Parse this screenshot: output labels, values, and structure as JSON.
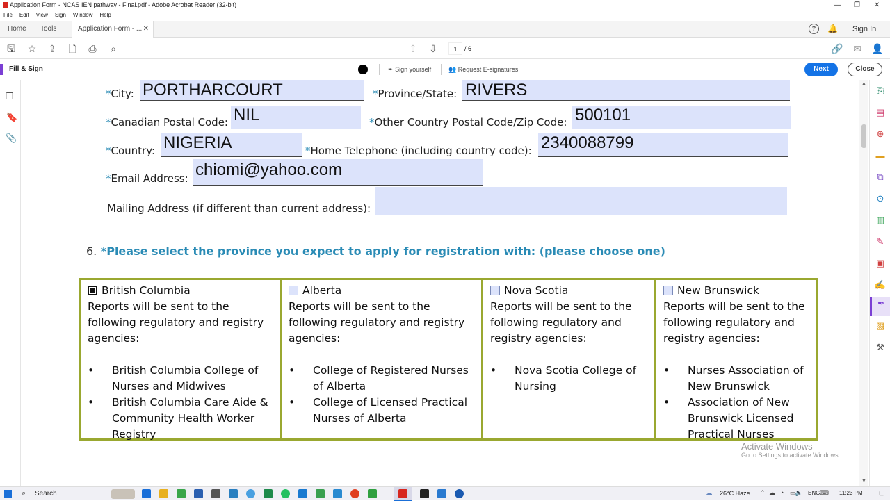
{
  "window": {
    "title": "Application Form - NCAS IEN pathway - Final.pdf - Adobe Acrobat Reader (32-bit)"
  },
  "menu": [
    "File",
    "Edit",
    "View",
    "Sign",
    "Window",
    "Help"
  ],
  "tabs": {
    "home": "Home",
    "tools": "Tools",
    "document": "Application Form - ...",
    "sign_in": "Sign In"
  },
  "toolbar": {
    "page_current": "1",
    "page_total": "/ 6"
  },
  "fill_sign": {
    "title": "Fill & Sign",
    "sign_yourself": "Sign yourself",
    "request": "Request E-signatures",
    "next": "Next",
    "close": "Close"
  },
  "form": {
    "city": {
      "label": "City:",
      "value": "PORTHARCOURT"
    },
    "province": {
      "label": "Province/State:",
      "value": "RIVERS"
    },
    "postal_ca": {
      "label": "Canadian Postal Code:",
      "value": "NIL"
    },
    "postal_other": {
      "label": "Other Country Postal Code/Zip Code:",
      "value": "500101"
    },
    "country": {
      "label": "Country:",
      "value": "NIGERIA"
    },
    "phone": {
      "label": "Home Telephone (including country code):",
      "value": "2340088799"
    },
    "email": {
      "label": "Email Address:",
      "value": "chiomi@yahoo.com"
    },
    "mailing": {
      "label": "Mailing Address (if different than current address):",
      "value": ""
    },
    "asterisk": "*"
  },
  "question6": {
    "number": "6.",
    "text": "*Please select the province you expect to apply for registration with: (please choose one)"
  },
  "provinces": [
    {
      "name": "British Columbia",
      "checked": true,
      "intro": "Reports will be sent to the following regulatory and registry agencies:",
      "agencies": [
        "British Columbia College of Nurses and Midwives",
        "British Columbia Care Aide & Community Health Worker Registry"
      ]
    },
    {
      "name": "Alberta",
      "checked": false,
      "intro": "Reports will be sent to the following regulatory and registry agencies:",
      "agencies": [
        "College of Registered Nurses of Alberta",
        "College of Licensed Practical Nurses of Alberta"
      ]
    },
    {
      "name": "Nova Scotia",
      "checked": false,
      "intro": "Reports will be sent to the following regulatory and registry agencies:",
      "agencies": [
        "Nova Scotia College of Nursing"
      ]
    },
    {
      "name": "New Brunswick",
      "checked": false,
      "intro": "Reports will be sent to the following regulatory and registry agencies:",
      "agencies": [
        "Nurses Association of New Brunswick",
        "Association of New Brunswick Licensed Practical Nurses"
      ]
    }
  ],
  "watermark": {
    "line1": "Activate Windows",
    "line2": "Go to Settings to activate Windows."
  },
  "taskbar": {
    "search": "Search",
    "weather": "26°C Haze",
    "lang": "ENG",
    "time": "11:23 PM"
  }
}
